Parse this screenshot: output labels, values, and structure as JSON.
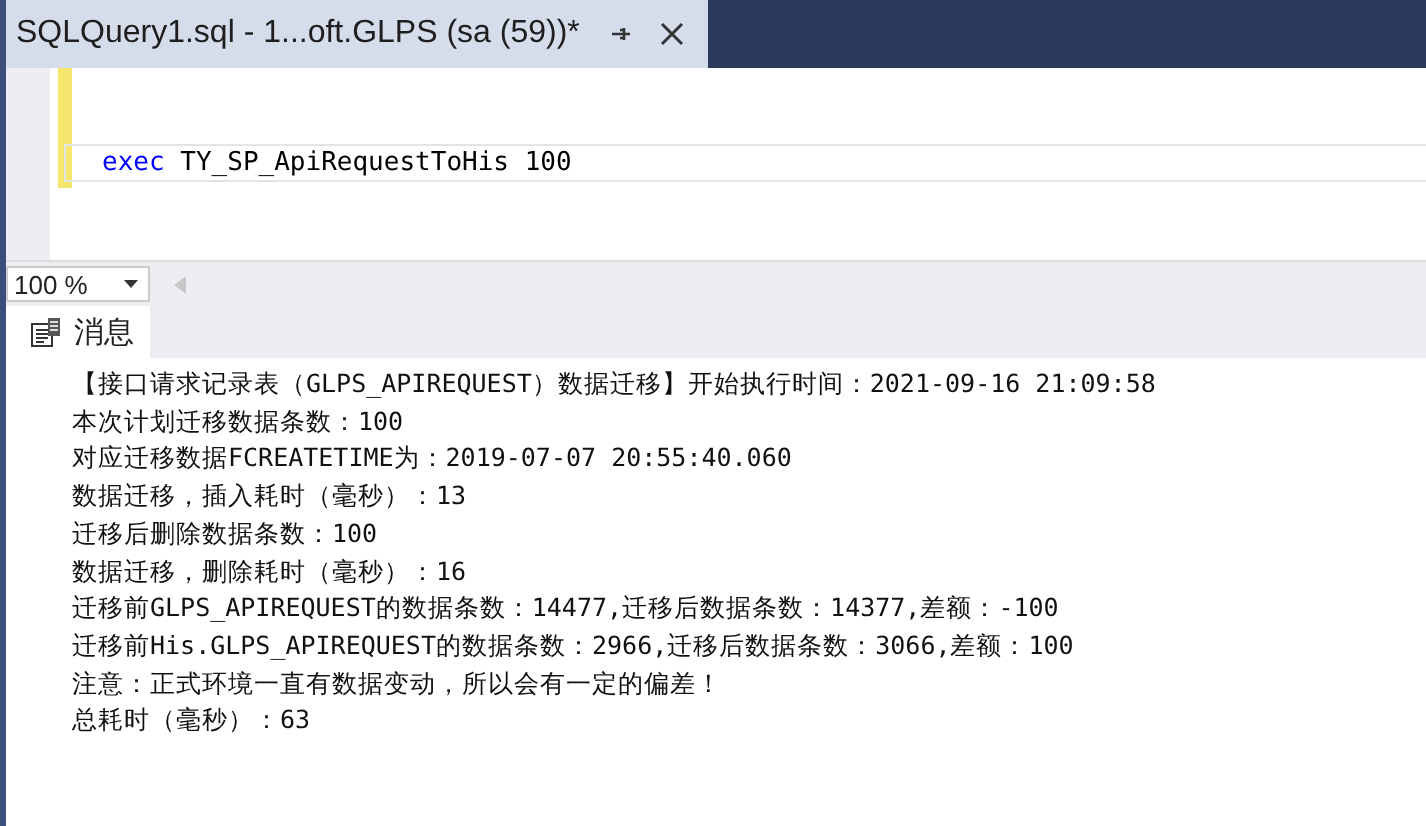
{
  "document_tab": {
    "title": "SQLQuery1.sql - 1...oft.GLPS (sa (59))*",
    "selected": true
  },
  "editor": {
    "lines": [
      {
        "keyword": "exec",
        "text": " TY_SP_ApiRequestToHis 100"
      }
    ]
  },
  "zoom": {
    "value": "100 %"
  },
  "results_tabs": [
    {
      "label": "消息",
      "selected": true
    }
  ],
  "messages": [
    "【接口请求记录表（GLPS_APIREQUEST）数据迁移】开始执行时间：2021-09-16 21:09:58",
    "本次计划迁移数据条数：100",
    "对应迁移数据FCREATETIME为：2019-07-07 20:55:40.060",
    "数据迁移，插入耗时（毫秒）：13",
    "迁移后删除数据条数：100",
    "数据迁移，删除耗时（毫秒）：16",
    "迁移前GLPS_APIREQUEST的数据条数：14477,迁移后数据条数：14377,差额：-100",
    "迁移前His.GLPS_APIREQUEST的数据条数：2966,迁移后数据条数：3066,差额：100",
    "注意：正式环境一直有数据变动，所以会有一定的偏差！",
    "总耗时（毫秒）：63"
  ]
}
